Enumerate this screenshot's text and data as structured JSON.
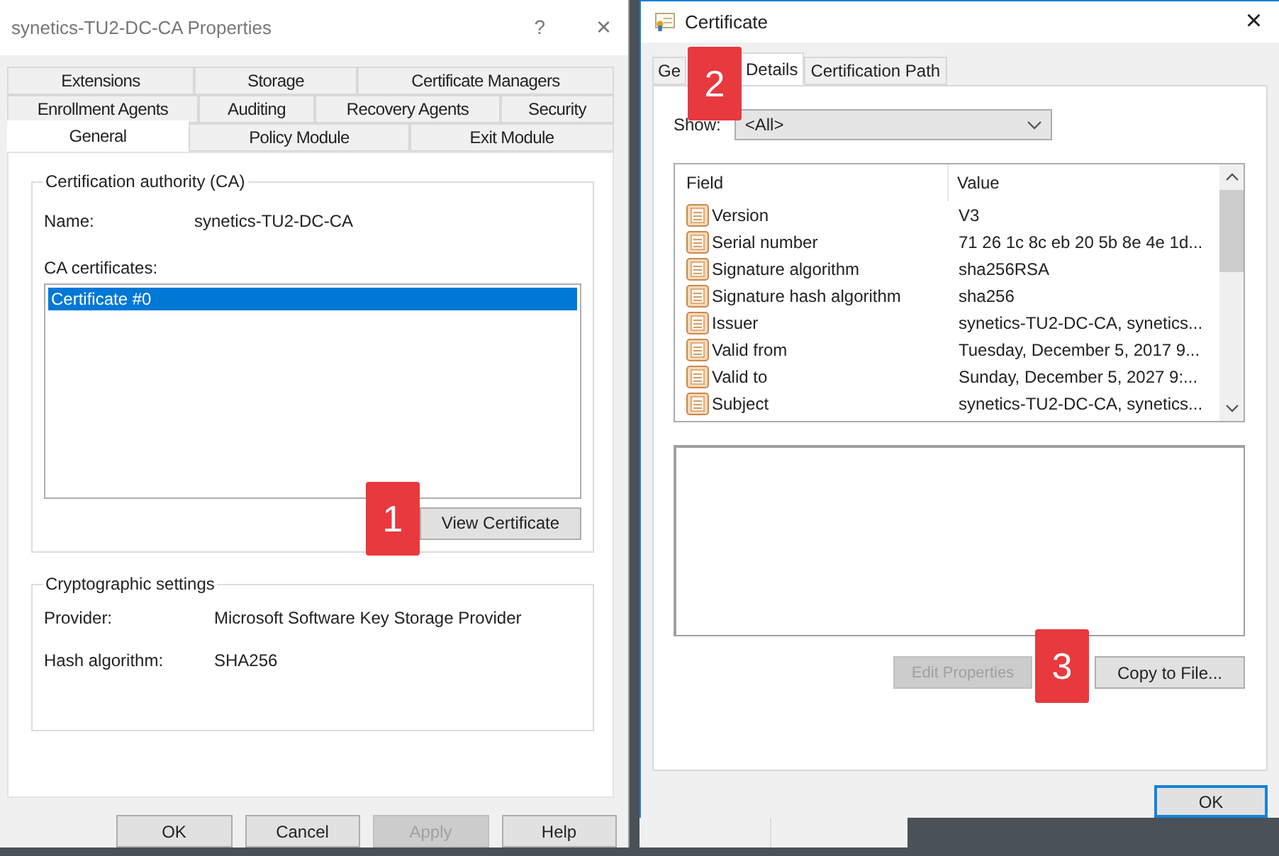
{
  "properties_window": {
    "title": "synetics-TU2-DC-CA Properties",
    "help_glyph": "?",
    "close_glyph": "×",
    "tab_rows": [
      [
        {
          "label": "Extensions",
          "selected": false
        },
        {
          "label": "Storage",
          "selected": false
        },
        {
          "label": "Certificate Managers",
          "selected": false
        }
      ],
      [
        {
          "label": "Enrollment Agents",
          "selected": false
        },
        {
          "label": "Auditing",
          "selected": false
        },
        {
          "label": "Recovery Agents",
          "selected": false
        },
        {
          "label": "Security",
          "selected": false
        }
      ],
      [
        {
          "label": "General",
          "selected": true
        },
        {
          "label": "Policy Module",
          "selected": false
        },
        {
          "label": "Exit Module",
          "selected": false
        }
      ]
    ],
    "ca_group": {
      "legend": "Certification authority (CA)",
      "name_label": "Name:",
      "name_value": "synetics-TU2-DC-CA",
      "certificates_label": "CA certificates:",
      "certificates": [
        {
          "label": "Certificate #0",
          "selected": true
        }
      ],
      "view_button": "View Certificate"
    },
    "crypto_group": {
      "legend": "Cryptographic settings",
      "rows": [
        {
          "label": "Provider:",
          "value": "Microsoft Software Key Storage Provider"
        },
        {
          "label": "Hash algorithm:",
          "value": "SHA256"
        }
      ]
    },
    "buttons": [
      {
        "label": "OK",
        "disabled": false
      },
      {
        "label": "Cancel",
        "disabled": false
      },
      {
        "label": "Apply",
        "disabled": true
      },
      {
        "label": "Help",
        "disabled": false
      }
    ]
  },
  "certificate_window": {
    "title": "Certificate",
    "close_glyph": "×",
    "tabs": [
      {
        "label": "Ge",
        "selected": false
      },
      {
        "label": "Details",
        "selected": true
      },
      {
        "label": "Certification Path",
        "selected": false
      }
    ],
    "show_label": "Show:",
    "show_value": "<All>",
    "columns": [
      "Field",
      "Value"
    ],
    "fields": [
      {
        "name": "Version",
        "value": "V3"
      },
      {
        "name": "Serial number",
        "value": "71 26 1c 8c eb 20 5b 8e 4e 1d..."
      },
      {
        "name": "Signature algorithm",
        "value": "sha256RSA"
      },
      {
        "name": "Signature hash algorithm",
        "value": "sha256"
      },
      {
        "name": "Issuer",
        "value": "synetics-TU2-DC-CA, synetics..."
      },
      {
        "name": "Valid from",
        "value": "Tuesday, December 5, 2017 9..."
      },
      {
        "name": "Valid to",
        "value": "Sunday, December 5, 2027 9:..."
      },
      {
        "name": "Subject",
        "value": "synetics-TU2-DC-CA, synetics..."
      }
    ],
    "buttons": [
      {
        "label": "Edit Properties",
        "disabled": true
      },
      {
        "label": "Copy to File...",
        "disabled": false
      }
    ],
    "dialog_buttons": [
      {
        "label": "OK",
        "default": true
      }
    ]
  },
  "callouts": [
    "1",
    "2",
    "3"
  ]
}
